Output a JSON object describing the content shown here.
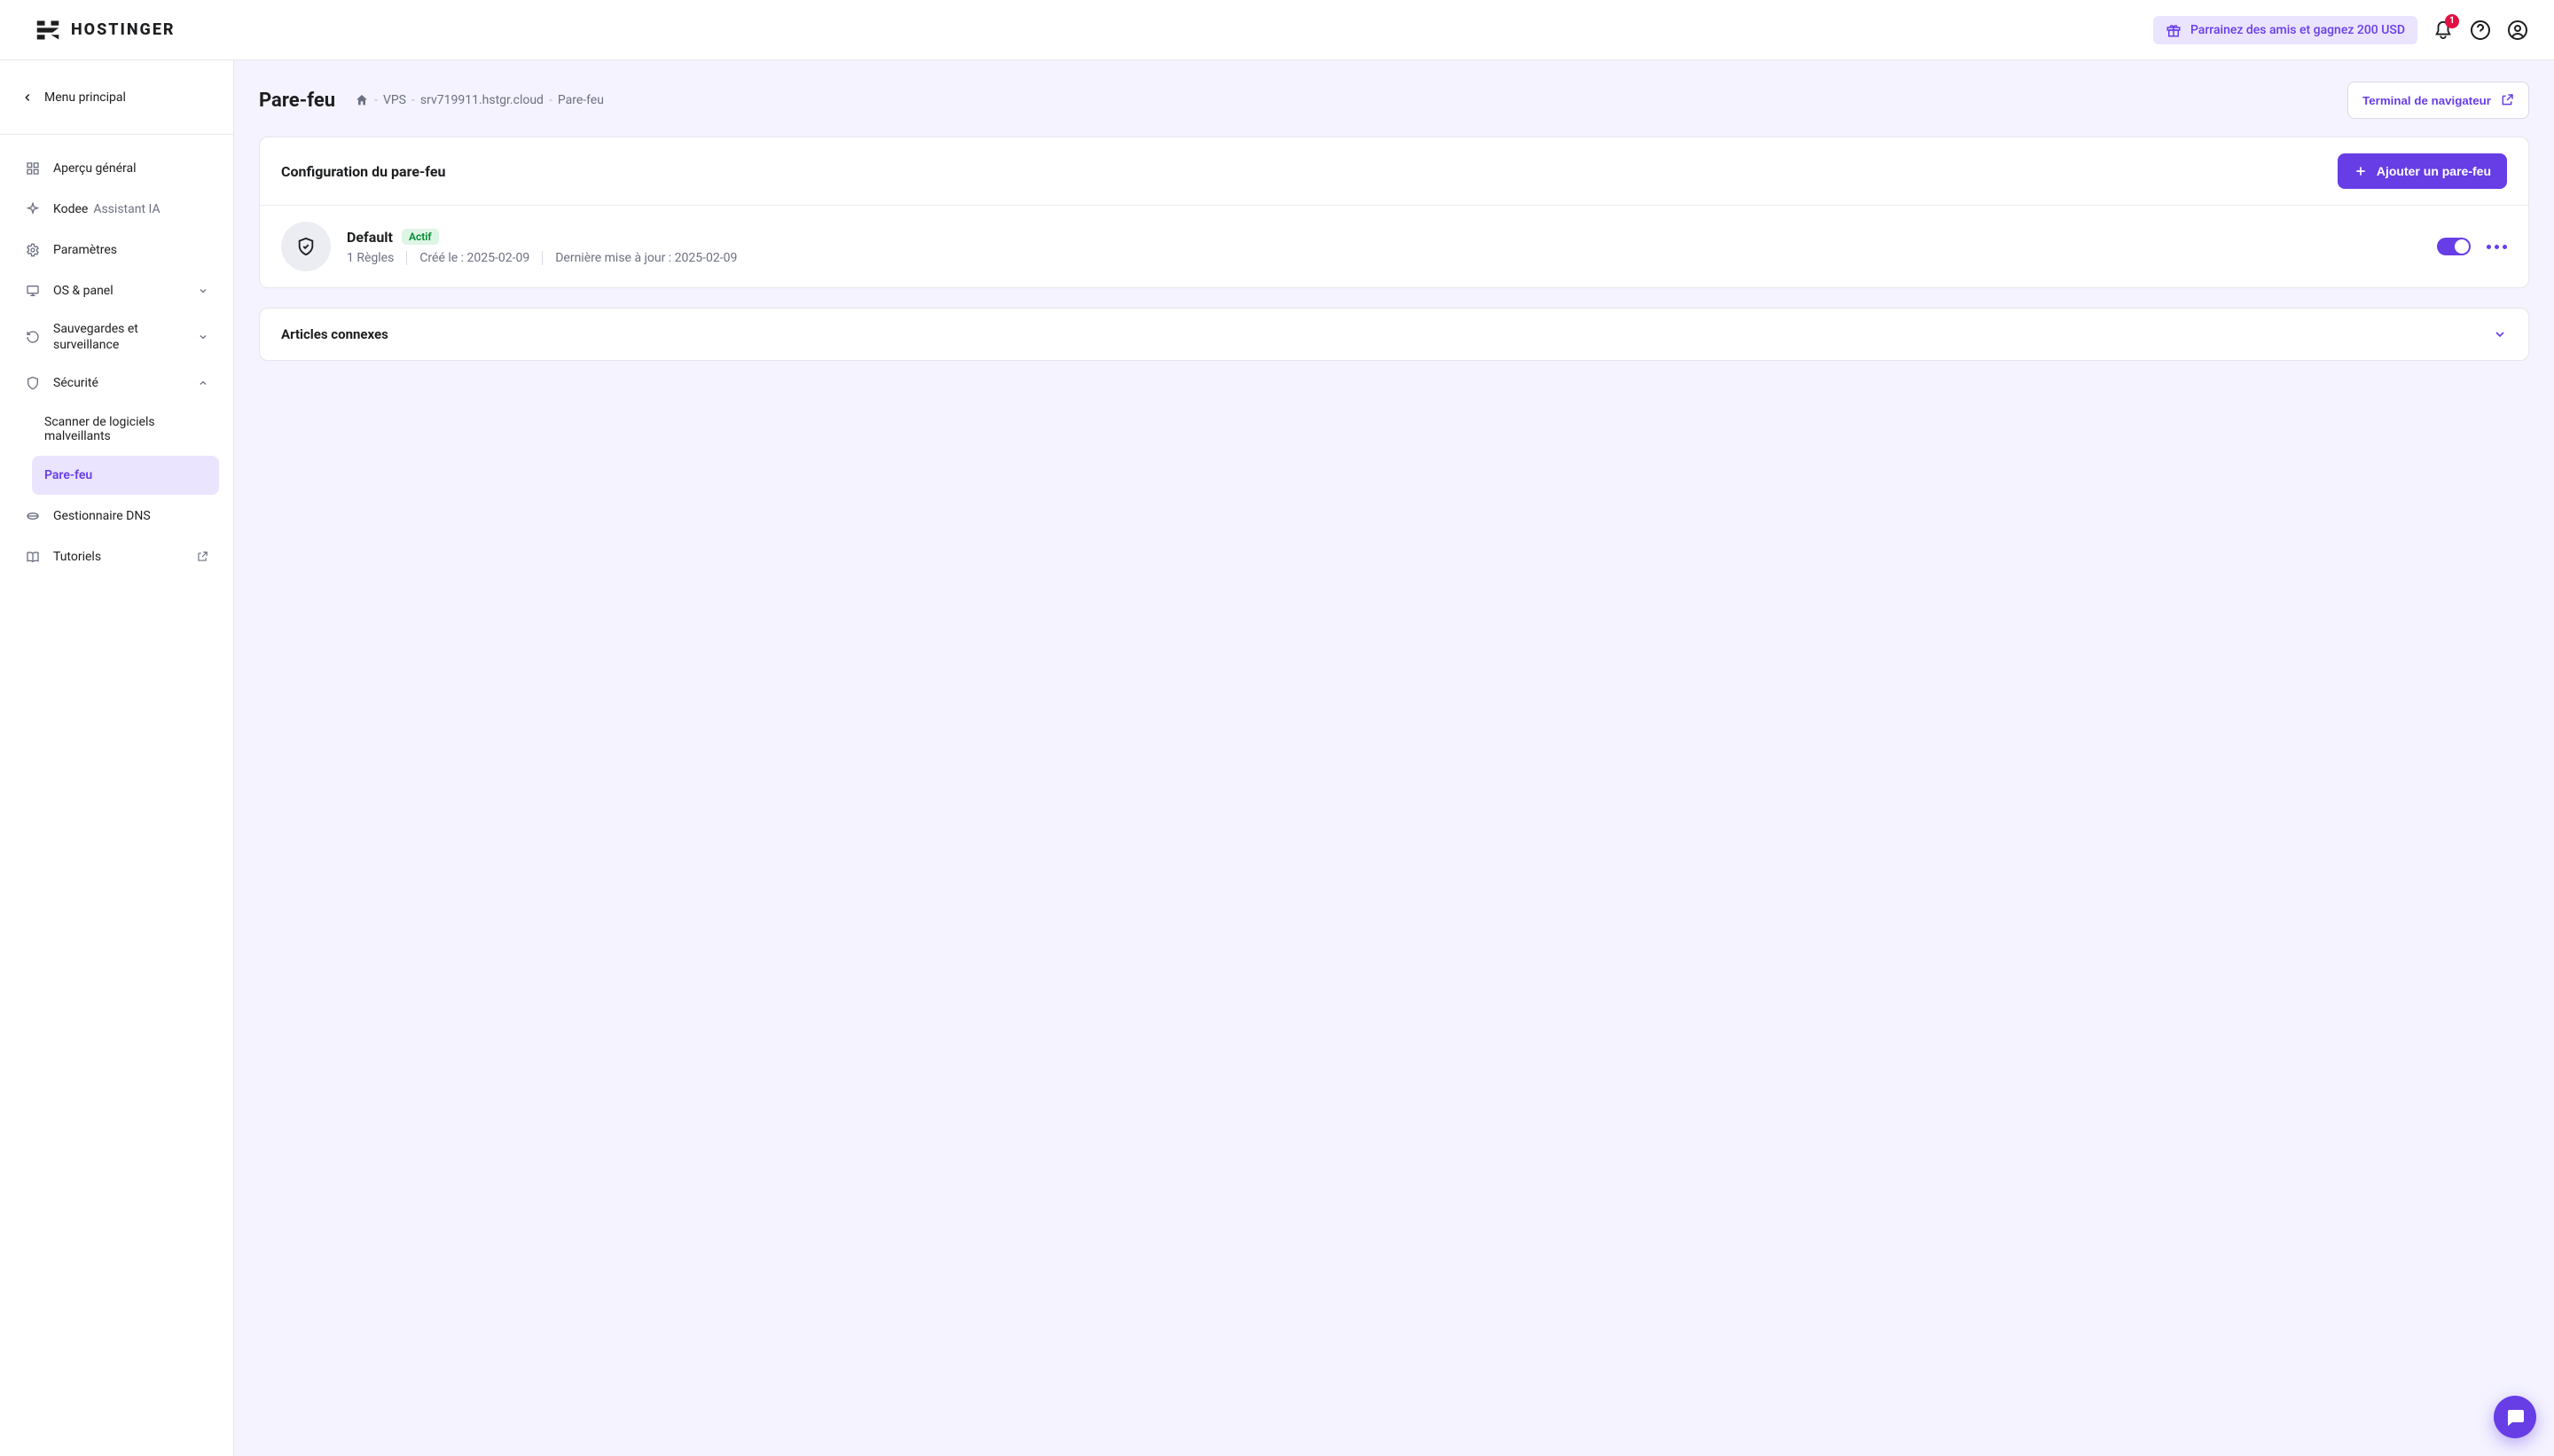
{
  "brand": {
    "name": "HOSTINGER"
  },
  "topnav": {
    "refer_label": "Parrainez des amis et gagnez 200 USD",
    "notif_count": "1"
  },
  "sidebar": {
    "main_menu_label": "Menu principal",
    "items": {
      "overview": "Aperçu général",
      "kodee": "Kodee",
      "kodee_sub": "Assistant IA",
      "settings": "Paramètres",
      "os_panel": "OS & panel",
      "backups": "Sauvegardes et surveillance",
      "security": "Sécurité",
      "security_children": {
        "malware": "Scanner de logiciels malveillants",
        "firewall": "Pare-feu"
      },
      "dns": "Gestionnaire DNS",
      "tutorials": "Tutoriels"
    }
  },
  "page": {
    "title": "Pare-feu",
    "breadcrumb": {
      "seg1": "VPS",
      "seg2": "srv719911.hstgr.cloud",
      "seg3": "Pare-feu"
    },
    "terminal_btn": "Terminal de navigateur"
  },
  "firewall_card": {
    "heading": "Configuration du pare-feu",
    "add_btn": "Ajouter un pare-feu",
    "entry": {
      "name": "Default",
      "badge": "Actif",
      "rules": "1 Règles",
      "created": "Créé le : 2025-02-09",
      "updated": "Dernière mise à jour : 2025-02-09"
    }
  },
  "related": {
    "heading": "Articles connexes"
  }
}
